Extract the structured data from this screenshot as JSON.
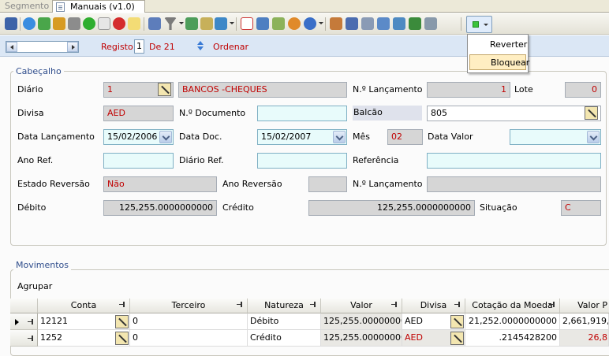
{
  "tabs": [
    {
      "label": "Segmento"
    },
    {
      "label": "Manuais (v1.0)"
    }
  ],
  "dropdown_menu": {
    "items": [
      "Reverter",
      "Bloquear"
    ],
    "highlighted": "Bloquear"
  },
  "nav": {
    "registo_label": "Registo",
    "registo_value": "1",
    "de_label": "De 21",
    "ordenar_label": "Ordenar"
  },
  "cabecalho": {
    "title": "Cabeçalho",
    "diario_label": "Diário",
    "diario_value": "1",
    "diario_desc": "BANCOS -CHEQUES",
    "nlancamento_label": "N.º Lançamento",
    "nlancamento_value": "1",
    "lote_label": "Lote",
    "lote_value": "0",
    "divisa_label": "Divisa",
    "divisa_value": "AED",
    "ndocumento_label": "N.º Documento",
    "ndocumento_value": "",
    "balcao_label": "Balcão",
    "balcao_value": "805",
    "data_lancamento_label": "Data Lançamento",
    "data_lancamento_value": "15/02/2006",
    "data_doc_label": "Data Doc.",
    "data_doc_value": "15/02/2007",
    "mes_label": "Mês",
    "mes_value": "02",
    "data_valor_label": "Data Valor",
    "data_valor_value": "",
    "ano_ref_label": "Ano Ref.",
    "diario_ref_label": "Diário Ref.",
    "referencia_label": "Referência",
    "estado_reversao_label": "Estado Reversão",
    "estado_reversao_value": "Não",
    "ano_reversao_label": "Ano Reversão",
    "nlancamento2_label": "N.º Lançamento",
    "debito_label": "Débito",
    "debito_value": "125,255.0000000000",
    "credito_label": "Crédito",
    "credito_value": "125,255.0000000000",
    "situacao_label": "Situação",
    "situacao_value": "C"
  },
  "movimentos": {
    "title": "Movimentos",
    "agrupar_label": "Agrupar",
    "columns": [
      "Conta",
      "Terceiro",
      "Natureza",
      "Valor",
      "Divisa",
      "Cotação da Moeda",
      "Valor P"
    ],
    "rows": [
      {
        "conta": "12121",
        "terceiro": "0",
        "natureza": "Débito",
        "valor": "125,255.00000000",
        "divisa": "AED",
        "cotacao": "21,252.0000000000",
        "valor_p": "2,661,919,"
      },
      {
        "conta": "1252",
        "terceiro": "0",
        "natureza": "Crédito",
        "valor": "125,255.00000000",
        "divisa": "AED",
        "cotacao": ".2145428200",
        "valor_p": "26,8"
      }
    ]
  },
  "colors": {
    "accent_red": "#c00000",
    "group_title": "#2f4d8c",
    "menu_highlight": "#ffeec2"
  }
}
